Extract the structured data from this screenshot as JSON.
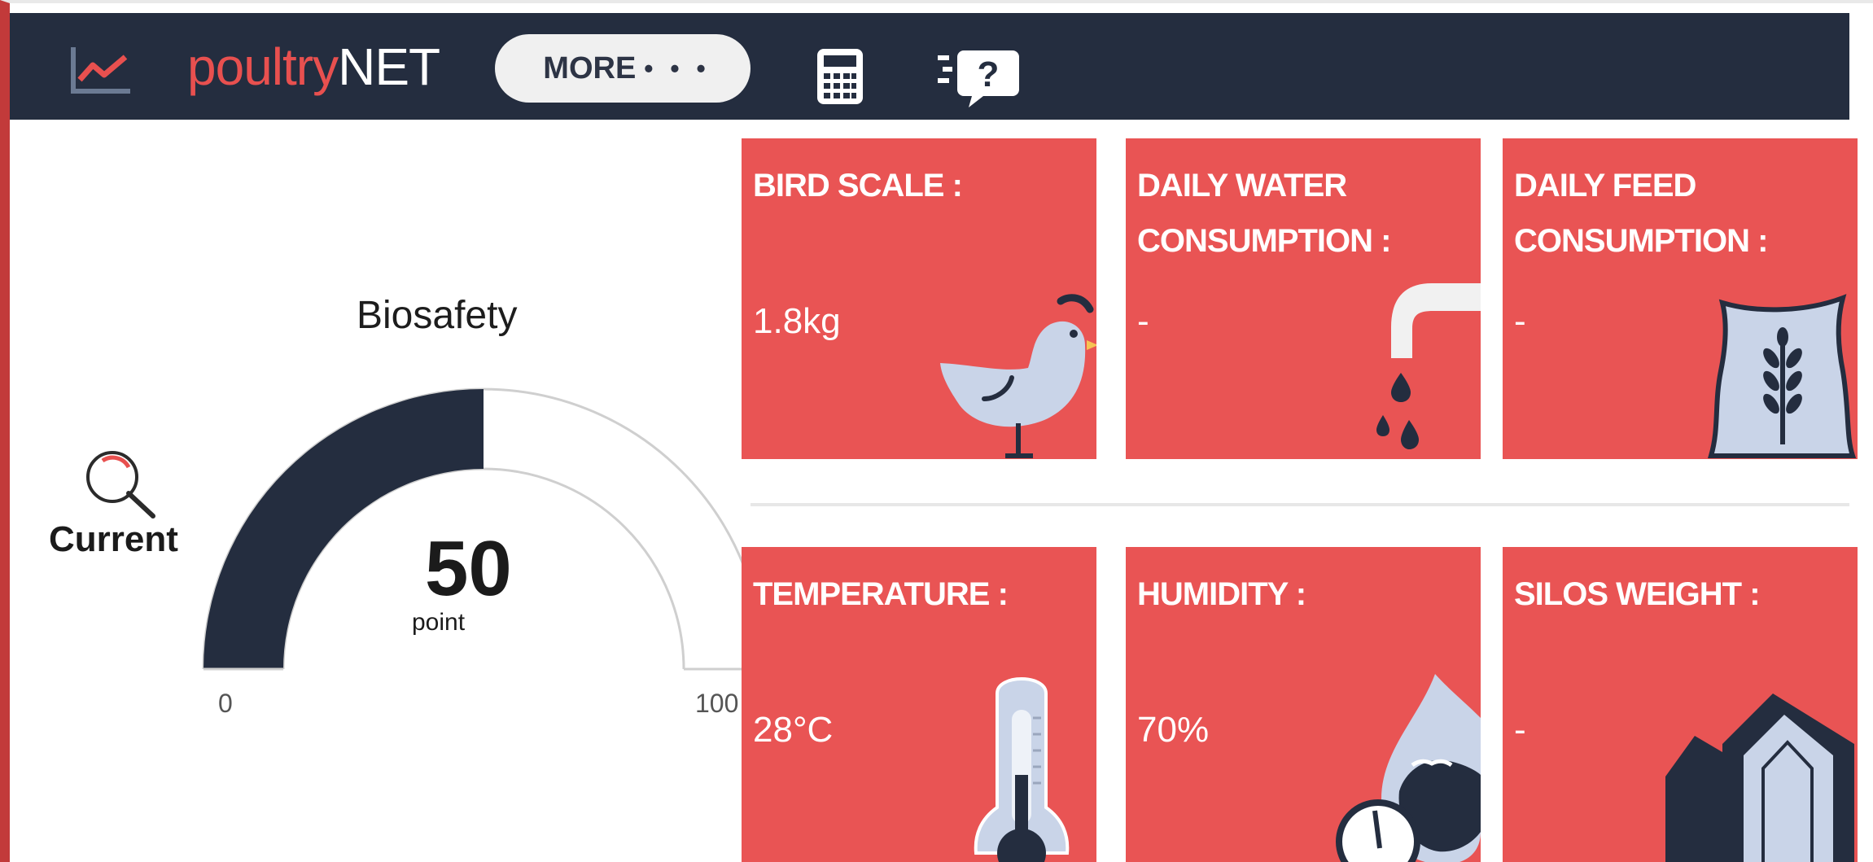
{
  "header": {
    "brand_part1": "poultry",
    "brand_part2": "NET",
    "more_label": "MORE",
    "more_dots": "• • •",
    "icons": [
      "chart-icon",
      "calculator-icon",
      "help-chat-icon"
    ]
  },
  "gauge": {
    "title": "Biosafety",
    "value": "50",
    "unit": "point",
    "min": "0",
    "max": "100",
    "fraction": 0.5,
    "current_label": "Current"
  },
  "cards": [
    {
      "label_lines": [
        "BIRD SCALE :"
      ],
      "value": "1.8kg",
      "icon": "chicken-icon"
    },
    {
      "label_lines": [
        "DAILY WATER",
        "CONSUMPTION :"
      ],
      "value": "-",
      "icon": "faucet-icon"
    },
    {
      "label_lines": [
        "DAILY FEED",
        "CONSUMPTION :"
      ],
      "value": "-",
      "icon": "feed-sack-icon"
    },
    {
      "label_lines": [
        "TEMPERATURE :"
      ],
      "value": "28°C",
      "icon": "thermometer-icon"
    },
    {
      "label_lines": [
        "HUMIDITY :"
      ],
      "value": "70%",
      "icon": "humidity-drop-icon"
    },
    {
      "label_lines": [
        "SILOS WEIGHT :"
      ],
      "value": "-",
      "icon": "silo-icon"
    }
  ],
  "colors": {
    "header_bg": "#242d3f",
    "brand_accent": "#e8504f",
    "card_bg": "#e95454",
    "gauge_fill": "#242d3f",
    "icon_light": "#c9d4e8"
  }
}
